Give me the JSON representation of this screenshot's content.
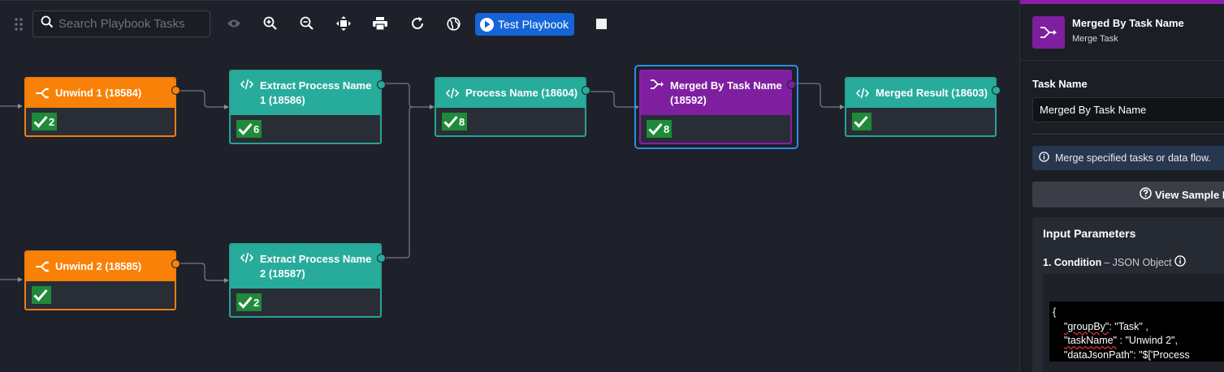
{
  "toolbar": {
    "search_placeholder": "Search Playbook Tasks",
    "test_button_label": "Test Playbook"
  },
  "nodes": {
    "unwind1": {
      "title": "Unwind 1 (18584)",
      "count": "2",
      "color": "#f98108"
    },
    "unwind2": {
      "title": "Unwind 2 (18585)",
      "count": "",
      "color": "#f98108"
    },
    "extract1": {
      "title_line1": "Extract Process Name",
      "title_line2": "1 (18586)",
      "count": "6",
      "color": "#27ac9c"
    },
    "extract2": {
      "title_line1": "Extract Process Name",
      "title_line2": "2 (18587)",
      "count": "2",
      "color": "#27ac9c"
    },
    "process_name": {
      "title": "Process Name (18604)",
      "count": "8",
      "color": "#27ac9c"
    },
    "merged_by": {
      "title_line1": "Merged By Task Name",
      "title_line2": "(18592)",
      "count": "8",
      "color": "#7f1f9f"
    },
    "merged_result": {
      "title": "Merged Result (18603)",
      "count": "",
      "color": "#27ac9c"
    }
  },
  "panel": {
    "title": "Merged By Task Name",
    "subtitle": "Merge Task",
    "task_name_label": "Task Name",
    "task_name_value": "Merged By Task Name",
    "info_text": "Merge specified tasks or data flow.",
    "sample_button_label": "View Sample D",
    "input_parameters_label": "Input Parameters",
    "condition_label": "1. Condition",
    "condition_type": "– JSON Object",
    "code_line1": "{",
    "code_l2_key": "\"groupBy\"",
    "code_l2_rest": ": \"Task\" ,",
    "code_l3_key": "\"taskName\"",
    "code_l3_rest": " : \"Unwind 2\",",
    "code_line4": "\"dataJsonPath\": \"$['Process"
  }
}
